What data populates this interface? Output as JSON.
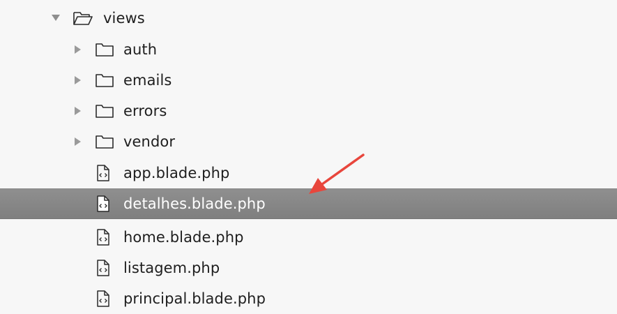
{
  "tree": {
    "root": {
      "label": "views",
      "icon": "folder-open-icon",
      "expanded": true
    },
    "folders": [
      {
        "label": "auth",
        "icon": "folder-icon",
        "expanded": false
      },
      {
        "label": "emails",
        "icon": "folder-icon",
        "expanded": false
      },
      {
        "label": "errors",
        "icon": "folder-icon",
        "expanded": false
      },
      {
        "label": "vendor",
        "icon": "folder-icon",
        "expanded": false
      }
    ],
    "files": [
      {
        "label": "app.blade.php",
        "icon": "code-file-icon",
        "selected": false
      },
      {
        "label": "detalhes.blade.php",
        "icon": "code-file-icon",
        "selected": true
      },
      {
        "label": "home.blade.php",
        "icon": "code-file-icon",
        "selected": false
      },
      {
        "label": "listagem.php",
        "icon": "code-file-icon",
        "selected": false
      },
      {
        "label": "principal.blade.php",
        "icon": "code-file-icon",
        "selected": false
      }
    ]
  },
  "colors": {
    "background": "#f7f7f7",
    "selection": "#8a8a8a",
    "arrow": "#e8463c"
  }
}
